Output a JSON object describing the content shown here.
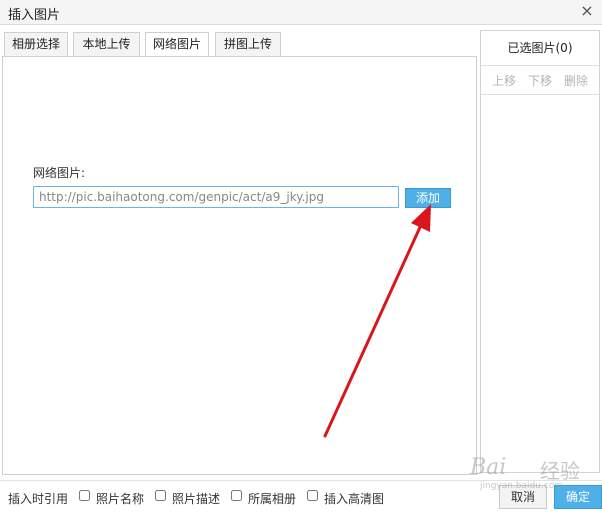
{
  "dialog": {
    "title": "插入图片",
    "close_glyph": "×"
  },
  "tabs": [
    {
      "label": "相册选择",
      "active": false
    },
    {
      "label": "本地上传",
      "active": false
    },
    {
      "label": "网络图片",
      "active": true
    },
    {
      "label": "拼图上传",
      "active": false
    }
  ],
  "network_image": {
    "field_label": "网络图片:",
    "url_value": "http://pic.baihaotong.com/genpic/act/a9_jky.jpg",
    "add_label": "添加"
  },
  "selected_panel": {
    "header": "已选图片(0)",
    "tools": [
      "上移",
      "下移",
      "删除"
    ],
    "count": 0
  },
  "footer": {
    "insert_reference_label": "插入时引用",
    "options": [
      {
        "label": "照片名称",
        "checked": false
      },
      {
        "label": "照片描述",
        "checked": false
      },
      {
        "label": "所属相册",
        "checked": false
      },
      {
        "label": "插入高清图",
        "checked": false
      }
    ],
    "cancel_label": "取消",
    "confirm_label": "确定"
  },
  "watermark": {
    "brand": "Bai",
    "suffix": "经验",
    "url": "jingyan.baidu.com"
  },
  "colors": {
    "accent": "#4fb0e8",
    "input_border": "#66b6de",
    "annotation_arrow": "#d9161c"
  }
}
